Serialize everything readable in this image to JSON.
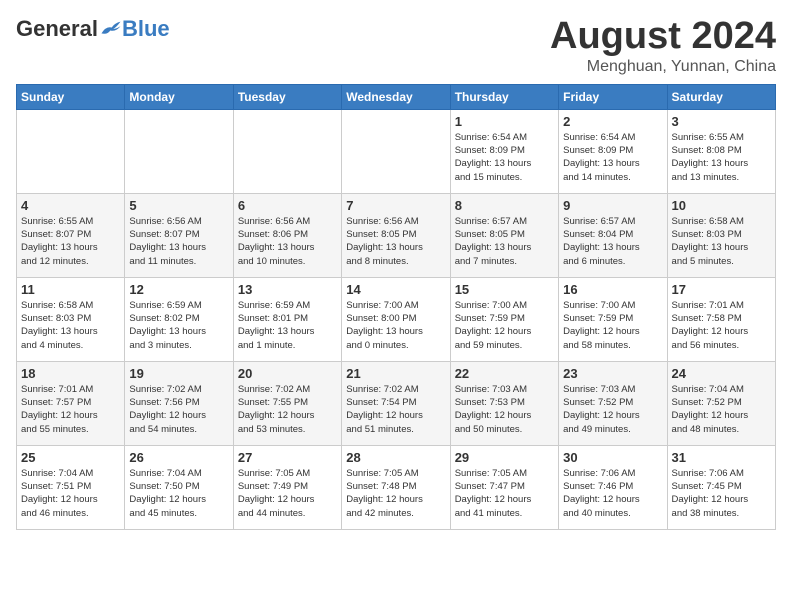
{
  "header": {
    "logo": {
      "general": "General",
      "blue": "Blue"
    },
    "title": "August 2024",
    "location": "Menghuan, Yunnan, China"
  },
  "weekdays": [
    "Sunday",
    "Monday",
    "Tuesday",
    "Wednesday",
    "Thursday",
    "Friday",
    "Saturday"
  ],
  "weeks": [
    [
      {
        "day": "",
        "info": ""
      },
      {
        "day": "",
        "info": ""
      },
      {
        "day": "",
        "info": ""
      },
      {
        "day": "",
        "info": ""
      },
      {
        "day": "1",
        "info": "Sunrise: 6:54 AM\nSunset: 8:09 PM\nDaylight: 13 hours\nand 15 minutes."
      },
      {
        "day": "2",
        "info": "Sunrise: 6:54 AM\nSunset: 8:09 PM\nDaylight: 13 hours\nand 14 minutes."
      },
      {
        "day": "3",
        "info": "Sunrise: 6:55 AM\nSunset: 8:08 PM\nDaylight: 13 hours\nand 13 minutes."
      }
    ],
    [
      {
        "day": "4",
        "info": "Sunrise: 6:55 AM\nSunset: 8:07 PM\nDaylight: 13 hours\nand 12 minutes."
      },
      {
        "day": "5",
        "info": "Sunrise: 6:56 AM\nSunset: 8:07 PM\nDaylight: 13 hours\nand 11 minutes."
      },
      {
        "day": "6",
        "info": "Sunrise: 6:56 AM\nSunset: 8:06 PM\nDaylight: 13 hours\nand 10 minutes."
      },
      {
        "day": "7",
        "info": "Sunrise: 6:56 AM\nSunset: 8:05 PM\nDaylight: 13 hours\nand 8 minutes."
      },
      {
        "day": "8",
        "info": "Sunrise: 6:57 AM\nSunset: 8:05 PM\nDaylight: 13 hours\nand 7 minutes."
      },
      {
        "day": "9",
        "info": "Sunrise: 6:57 AM\nSunset: 8:04 PM\nDaylight: 13 hours\nand 6 minutes."
      },
      {
        "day": "10",
        "info": "Sunrise: 6:58 AM\nSunset: 8:03 PM\nDaylight: 13 hours\nand 5 minutes."
      }
    ],
    [
      {
        "day": "11",
        "info": "Sunrise: 6:58 AM\nSunset: 8:03 PM\nDaylight: 13 hours\nand 4 minutes."
      },
      {
        "day": "12",
        "info": "Sunrise: 6:59 AM\nSunset: 8:02 PM\nDaylight: 13 hours\nand 3 minutes."
      },
      {
        "day": "13",
        "info": "Sunrise: 6:59 AM\nSunset: 8:01 PM\nDaylight: 13 hours\nand 1 minute."
      },
      {
        "day": "14",
        "info": "Sunrise: 7:00 AM\nSunset: 8:00 PM\nDaylight: 13 hours\nand 0 minutes."
      },
      {
        "day": "15",
        "info": "Sunrise: 7:00 AM\nSunset: 7:59 PM\nDaylight: 12 hours\nand 59 minutes."
      },
      {
        "day": "16",
        "info": "Sunrise: 7:00 AM\nSunset: 7:59 PM\nDaylight: 12 hours\nand 58 minutes."
      },
      {
        "day": "17",
        "info": "Sunrise: 7:01 AM\nSunset: 7:58 PM\nDaylight: 12 hours\nand 56 minutes."
      }
    ],
    [
      {
        "day": "18",
        "info": "Sunrise: 7:01 AM\nSunset: 7:57 PM\nDaylight: 12 hours\nand 55 minutes."
      },
      {
        "day": "19",
        "info": "Sunrise: 7:02 AM\nSunset: 7:56 PM\nDaylight: 12 hours\nand 54 minutes."
      },
      {
        "day": "20",
        "info": "Sunrise: 7:02 AM\nSunset: 7:55 PM\nDaylight: 12 hours\nand 53 minutes."
      },
      {
        "day": "21",
        "info": "Sunrise: 7:02 AM\nSunset: 7:54 PM\nDaylight: 12 hours\nand 51 minutes."
      },
      {
        "day": "22",
        "info": "Sunrise: 7:03 AM\nSunset: 7:53 PM\nDaylight: 12 hours\nand 50 minutes."
      },
      {
        "day": "23",
        "info": "Sunrise: 7:03 AM\nSunset: 7:52 PM\nDaylight: 12 hours\nand 49 minutes."
      },
      {
        "day": "24",
        "info": "Sunrise: 7:04 AM\nSunset: 7:52 PM\nDaylight: 12 hours\nand 48 minutes."
      }
    ],
    [
      {
        "day": "25",
        "info": "Sunrise: 7:04 AM\nSunset: 7:51 PM\nDaylight: 12 hours\nand 46 minutes."
      },
      {
        "day": "26",
        "info": "Sunrise: 7:04 AM\nSunset: 7:50 PM\nDaylight: 12 hours\nand 45 minutes."
      },
      {
        "day": "27",
        "info": "Sunrise: 7:05 AM\nSunset: 7:49 PM\nDaylight: 12 hours\nand 44 minutes."
      },
      {
        "day": "28",
        "info": "Sunrise: 7:05 AM\nSunset: 7:48 PM\nDaylight: 12 hours\nand 42 minutes."
      },
      {
        "day": "29",
        "info": "Sunrise: 7:05 AM\nSunset: 7:47 PM\nDaylight: 12 hours\nand 41 minutes."
      },
      {
        "day": "30",
        "info": "Sunrise: 7:06 AM\nSunset: 7:46 PM\nDaylight: 12 hours\nand 40 minutes."
      },
      {
        "day": "31",
        "info": "Sunrise: 7:06 AM\nSunset: 7:45 PM\nDaylight: 12 hours\nand 38 minutes."
      }
    ]
  ]
}
